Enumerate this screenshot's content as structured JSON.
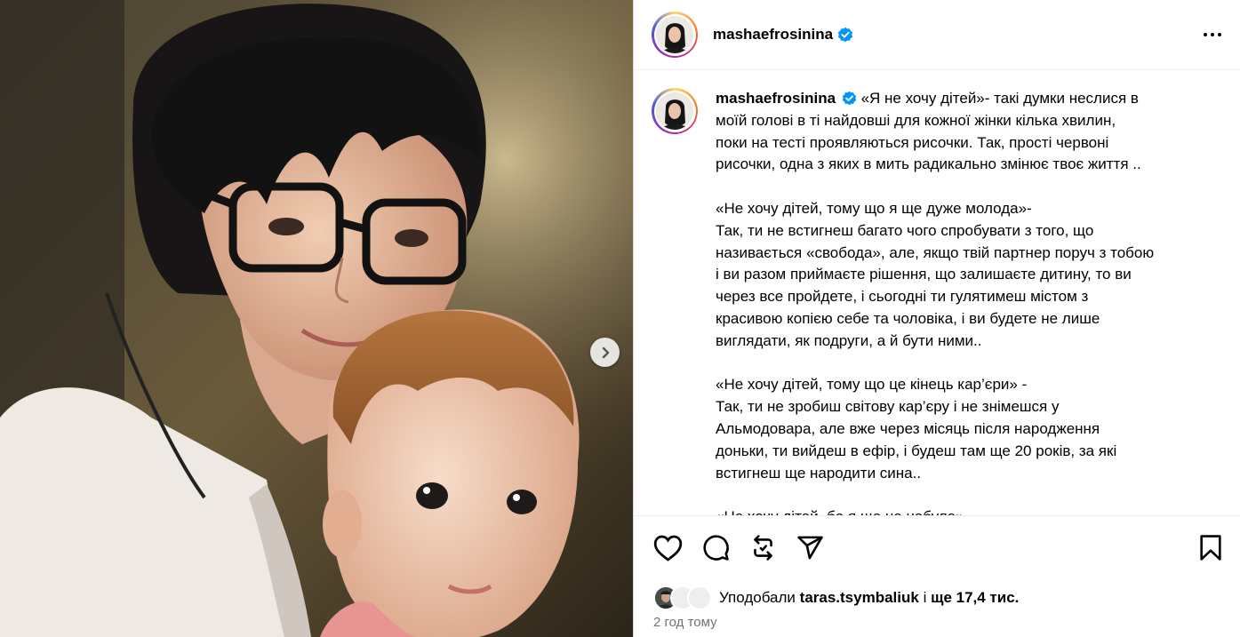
{
  "post": {
    "username": "mashaefrosinina",
    "verified": true
  },
  "caption": {
    "username": "mashaefrosinina",
    "lines": [
      "«Я не хочу дітей»- такі думки неслися в",
      "моїй голові в ті найдовші для кожної жінки кілька хвилин,",
      "поки на тесті проявляються рисочки. Так, прості червоні",
      "рисочки, одна з яких в мить радикально змінює твоє життя ..",
      "",
      "«Не хочу дітей, тому що я ще дуже молода»-",
      "Так, ти не встигнеш багато чого спробувати з того, що",
      "називається «свобода», але, якщо твій партнер поруч з тобою",
      "і ви разом приймаєте рішення, що залишаєте дитину, то ви",
      "через все пройдете, і сьогодні ти гулятимеш містом з",
      "красивою копією себе та чоловіка, і ви будете не лише",
      "виглядати, як подруги, а й бути ними..",
      "",
      "«Не хочу дітей, тому що це кінець кар’єри» -",
      "Так, ти не зробиш світову кар’єру і не знімешся у",
      "Альмодовара, але вже через місяць після народження",
      "доньки, ти вийдеш в ефір, і будеш там ще 20 років, за які",
      "встигнеш ще народити сина..",
      "",
      "«Не хочу дітей, бо я ще не набула»"
    ]
  },
  "likes": {
    "prefix": "Уподобали",
    "user": "taras.tsymbaliuk",
    "and": "і",
    "count": "ще 17,4 тис."
  },
  "timestamp": "2 год тому",
  "icons": {
    "like": "heart-icon",
    "comment": "comment-icon",
    "repost": "repost-icon",
    "share": "share-icon",
    "save": "bookmark-icon",
    "more": "more-icon",
    "next": "chevron-right-icon",
    "verified": "verified-badge-icon"
  },
  "colors": {
    "verified": "#0095f6",
    "muted": "#737373",
    "border": "#dbdbdb"
  }
}
